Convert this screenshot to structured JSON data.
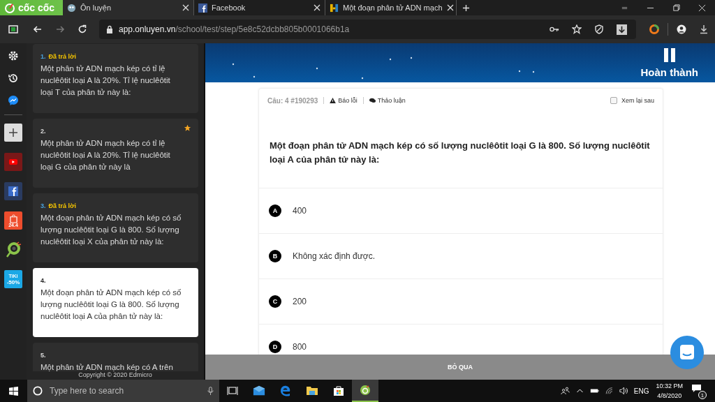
{
  "browser": {
    "logo_text": "cốc cốc",
    "tabs": [
      {
        "title": "Ôn luyện",
        "selected": true,
        "kind": "bird"
      },
      {
        "title": "Facebook",
        "selected": false,
        "kind": "facebook"
      },
      {
        "title": "Một đoạn phân tử ADN mạch",
        "selected": false,
        "kind": "hoc"
      }
    ],
    "url": {
      "host": "app.onluyen.vn",
      "path": "/school/test/step/5e8c52dcbb805b0001066b1a"
    },
    "shopee_badge": "24.4",
    "tiki_badge": {
      "name": "TiKi",
      "discount": "-50%"
    }
  },
  "question_list": [
    {
      "number": "1.",
      "status": "Đã trả lời",
      "text": "Một phân tử ADN mạch kép có tỉ lệ nuclêôtit loại A là 20%. Tỉ lệ nuclêôtit loại T của phân tử này là:",
      "starred": false,
      "selected": false
    },
    {
      "number": "2.",
      "text": "Một phân tử ADN mạch kép có tỉ lệ nuclêôtit loại A là 20%. Tỉ lệ nuclêôtit loại G của phân tử này là",
      "starred": true,
      "selected": false
    },
    {
      "number": "3.",
      "status": "Đã trả lời",
      "text": "Một đoạn phân tử ADN mạch kép có số lượng nuclêôtit loại G là 800. Số lượng nuclêôtit loại X của phân tử này là:",
      "starred": false,
      "selected": false
    },
    {
      "number": "4.",
      "text": "Một đoạn phân tử ADN mạch kép có số lượng nuclêôtit loại G là 800. Số lượng nuclêôtit loại A của phân tử này là:",
      "starred": false,
      "selected": true
    },
    {
      "number": "5.",
      "text": "Một phân tử ADN mạch kép có A trên",
      "starred": false,
      "selected": false
    }
  ],
  "copyright": "Copyright © 2020 Edmicro",
  "header": {
    "finish_label": "Hoàn thành"
  },
  "question": {
    "code": "Câu: 4 #190293",
    "report": "Báo lỗi",
    "discuss": "Thảo luận",
    "review_later": {
      "label": "Xem lại sau",
      "checked": false
    },
    "text": "Một đoạn phân tử ADN mạch kép có số lượng nuclêôtit loại G là 800. Số lượng nuclêôtit loại A của phân tử này là:",
    "options": [
      {
        "letter": "A",
        "text": "400",
        "selected": false
      },
      {
        "letter": "B",
        "text": "Không xác định được.",
        "selected": false
      },
      {
        "letter": "C",
        "text": "200",
        "selected": false
      },
      {
        "letter": "D",
        "text": "800",
        "selected": false
      }
    ]
  },
  "skip_label": "BỎ QUA",
  "taskbar": {
    "search_placeholder": "Type here to search",
    "language": "ENG",
    "time": "10:32 PM",
    "date": "4/8/2020",
    "notifications": "1"
  }
}
